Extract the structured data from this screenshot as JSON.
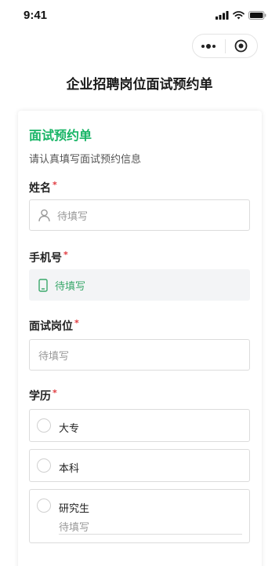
{
  "status": {
    "time": "9:41"
  },
  "page": {
    "title": "企业招聘岗位面试预约单"
  },
  "form": {
    "title": "面试预约单",
    "description": "请认真填写面试预约信息",
    "required_mark": "*",
    "fields": {
      "name": {
        "label": "姓名",
        "placeholder": "待填写",
        "icon": "user-icon"
      },
      "phone": {
        "label": "手机号",
        "placeholder": "待填写",
        "icon": "phone-icon"
      },
      "position": {
        "label": "面试岗位",
        "placeholder": "待填写"
      },
      "education": {
        "label": "学历",
        "options": [
          {
            "label": "大专"
          },
          {
            "label": "本科"
          },
          {
            "label": "研究生",
            "other_placeholder": "待填写"
          }
        ]
      }
    }
  },
  "colors": {
    "accent": "#18b566",
    "required": "#e0393e"
  }
}
